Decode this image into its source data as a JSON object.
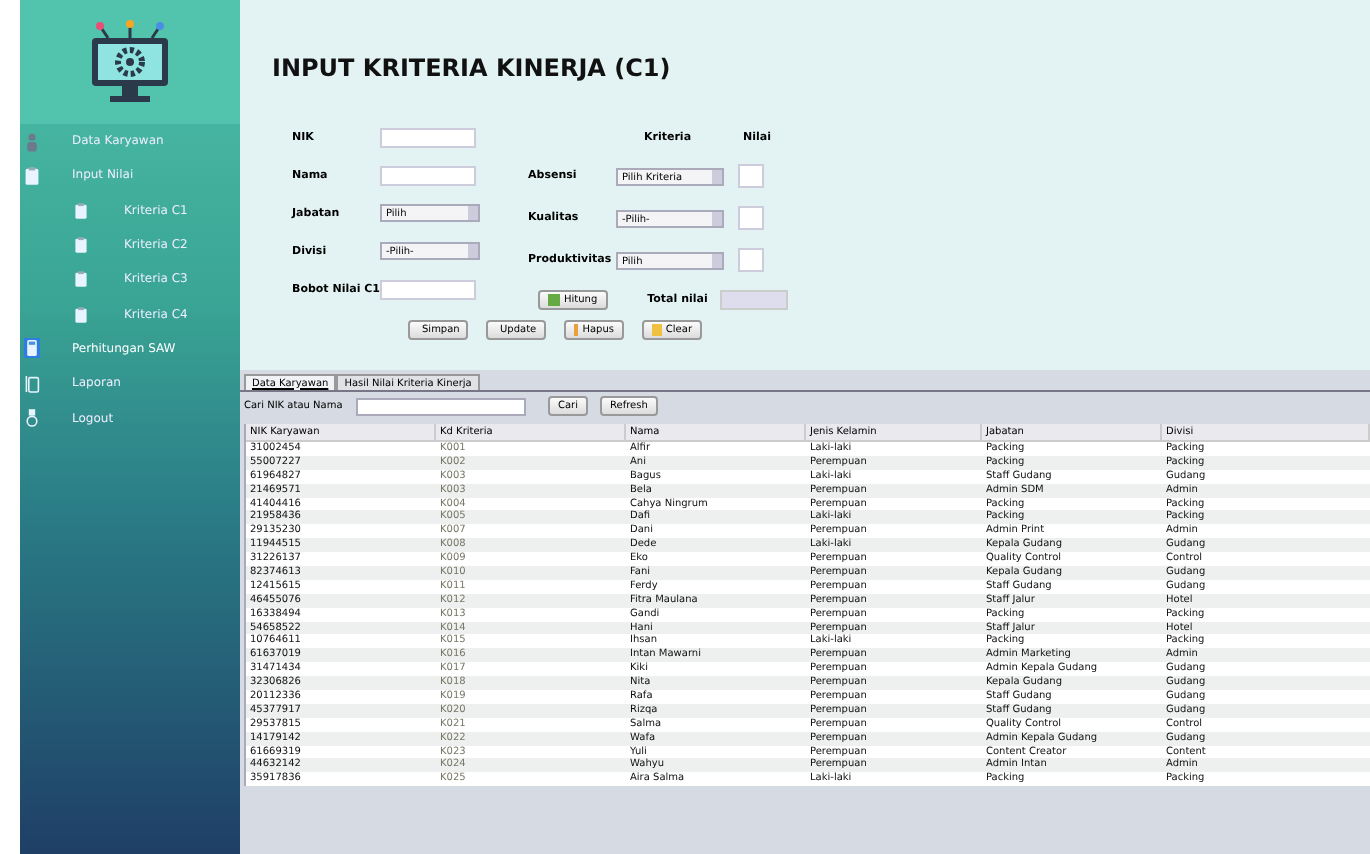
{
  "sidebar": {
    "items": [
      {
        "label": "Data Karyawan",
        "selected": false
      },
      {
        "label": "Input Nilai",
        "selected": false,
        "children": [
          {
            "label": "Kriteria C1",
            "selected": false
          },
          {
            "label": "Kriteria C2",
            "selected": false
          },
          {
            "label": "Kriteria C3",
            "selected": false
          },
          {
            "label": "Kriteria C4",
            "selected": false
          }
        ]
      },
      {
        "label": "Perhitungan SAW",
        "selected": true
      },
      {
        "label": "Laporan",
        "selected": false
      },
      {
        "label": "Logout",
        "selected": false
      }
    ]
  },
  "title": "INPUT KRITERIA KINERJA (C1)",
  "form": {
    "fields": [
      {
        "label": "NIK",
        "kind": "text"
      },
      {
        "label": "Nama",
        "kind": "text"
      },
      {
        "label": "Jabatan",
        "kind": "combo",
        "value": "Pilih"
      },
      {
        "label": "Divisi",
        "kind": "combo",
        "value": "-Pilih-"
      },
      {
        "label": "Bobot Nilai C1",
        "kind": "text"
      }
    ],
    "criteria_header": {
      "criteria": "Kriteria",
      "score": "Nilai"
    },
    "criteria": [
      {
        "label": "Absensi",
        "value": "Pilih Kriteria"
      },
      {
        "label": "Kualitas",
        "value": "-Pilih-"
      },
      {
        "label": "Produktivitas",
        "value": "Pilih"
      }
    ],
    "calculate_button": "Hitung",
    "total_label": "Total nilai",
    "buttons": [
      "Simpan",
      "Update",
      "Hapus",
      "Clear"
    ]
  },
  "tabs": [
    {
      "label": "Data Karyawan",
      "selected": true
    },
    {
      "label": "Hasil Nilai Kriteria Kinerja",
      "selected": false
    }
  ],
  "search": {
    "label": "Cari NIK atau Nama",
    "button": "Cari",
    "refresh": "Refresh"
  },
  "table": {
    "columns": [
      "NIK Karyawan",
      "Kd Kriteria",
      "Nama",
      "Jenis Kelamin",
      "Jabatan",
      "Divisi"
    ],
    "rows": [
      [
        "31002454",
        "K001",
        "Alfir",
        "Laki-laki",
        "Packing",
        "Packing"
      ],
      [
        "55007227",
        "K002",
        "Ani",
        "Perempuan",
        "Packing",
        "Packing"
      ],
      [
        "61964827",
        "K003",
        "Bagus",
        "Laki-laki",
        "Staff Gudang",
        "Gudang"
      ],
      [
        "21469571",
        "K003",
        "Bela",
        "Perempuan",
        "Admin SDM",
        "Admin"
      ],
      [
        "41404416",
        "K004",
        "Cahya Ningrum",
        "Perempuan",
        "Packing",
        "Packing"
      ],
      [
        "21958436",
        "K005",
        "Dafi",
        "Laki-laki",
        "Packing",
        "Packing"
      ],
      [
        "29135230",
        "K007",
        "Dani",
        "Perempuan",
        "Admin Print",
        "Admin"
      ],
      [
        "11944515",
        "K008",
        "Dede",
        "Laki-laki",
        "Kepala Gudang",
        "Gudang"
      ],
      [
        "31226137",
        "K009",
        "Eko",
        "Perempuan",
        "Quality Control",
        "Control"
      ],
      [
        "82374613",
        "K010",
        "Fani",
        "Perempuan",
        "Kepala Gudang",
        "Gudang"
      ],
      [
        "12415615",
        "K011",
        "Ferdy",
        "Perempuan",
        "Staff Gudang",
        "Gudang"
      ],
      [
        "46455076",
        "K012",
        "Fitra Maulana",
        "Perempuan",
        "Staff Jalur",
        "Hotel"
      ],
      [
        "16338494",
        "K013",
        "Gandi",
        "Perempuan",
        "Packing",
        "Packing"
      ],
      [
        "54658522",
        "K014",
        "Hani",
        "Perempuan",
        "Staff Jalur",
        "Hotel"
      ],
      [
        "10764611",
        "K015",
        "Ihsan",
        "Laki-laki",
        "Packing",
        "Packing"
      ],
      [
        "61637019",
        "K016",
        "Intan Mawarni",
        "Perempuan",
        "Admin Marketing",
        "Admin"
      ],
      [
        "31471434",
        "K017",
        "Kiki",
        "Perempuan",
        "Admin Kepala Gudang",
        "Gudang"
      ],
      [
        "32306826",
        "K018",
        "Nita",
        "Perempuan",
        "Kepala Gudang",
        "Gudang"
      ],
      [
        "20112336",
        "K019",
        "Rafa",
        "Perempuan",
        "Staff Gudang",
        "Gudang"
      ],
      [
        "45377917",
        "K020",
        "Rizqa",
        "Perempuan",
        "Staff Gudang",
        "Gudang"
      ],
      [
        "29537815",
        "K021",
        "Salma",
        "Perempuan",
        "Quality Control",
        "Control"
      ],
      [
        "14179142",
        "K022",
        "Wafa",
        "Perempuan",
        "Admin Kepala Gudang",
        "Gudang"
      ],
      [
        "61669319",
        "K023",
        "Yuli",
        "Perempuan",
        "Content Creator",
        "Content"
      ],
      [
        "44632142",
        "K024",
        "Wahyu",
        "Perempuan",
        "Admin Intan",
        "Admin"
      ],
      [
        "35917836",
        "K025",
        "Aira Salma",
        "Laki-laki",
        "Packing",
        "Packing"
      ]
    ]
  }
}
